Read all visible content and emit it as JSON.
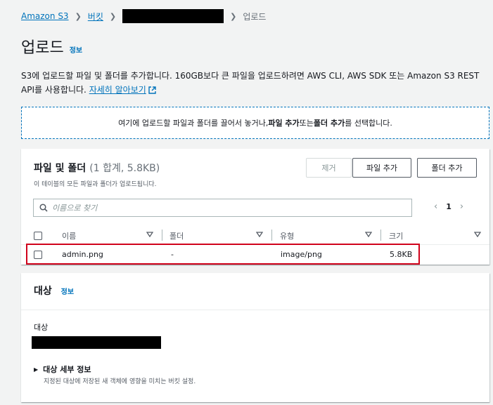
{
  "breadcrumb": {
    "items": [
      "Amazon S3",
      "버킷"
    ],
    "current": "업로드"
  },
  "page": {
    "title": "업로드",
    "info": "정보"
  },
  "description": {
    "text": "S3에 업로드할 파일 및 폴더를 추가합니다. 160GB보다 큰 파일을 업로드하려면 AWS CLI, AWS SDK 또는 Amazon S3 REST API를 사용합니다.",
    "link": "자세히 알아보기"
  },
  "dropzone": {
    "pre": "여기에 업로드할 파일과 폴더를 끌어서 놓거나, ",
    "add_file": "파일 추가",
    "mid": " 또는 ",
    "add_folder": "폴더 추가",
    "post": "를 선택합니다."
  },
  "files_panel": {
    "title": "파일 및 폴더",
    "count": "(1 합계, 5.8KB)",
    "subtitle": "이 테이블의 모든 파일과 폴더가 업로드됩니다.",
    "remove_button": "제거",
    "add_file_button": "파일 추가",
    "add_folder_button": "폴더 추가",
    "search_placeholder": "이름으로 찾기",
    "page": "1",
    "columns": [
      "이름",
      "폴더",
      "유형",
      "크기"
    ],
    "rows": [
      {
        "name": "admin.png",
        "folder": "-",
        "type": "image/png",
        "size": "5.8KB"
      }
    ]
  },
  "destination_panel": {
    "title": "대상",
    "info": "정보",
    "label": "대상",
    "details_title": "대상 세부 정보",
    "details_sub": "지정된 대상에 저장된 새 객체에 영향을 미치는 버킷 설정."
  },
  "colors": {
    "link": "#0073bb",
    "highlight": "#d0021b",
    "background": "#f2f3f3"
  }
}
